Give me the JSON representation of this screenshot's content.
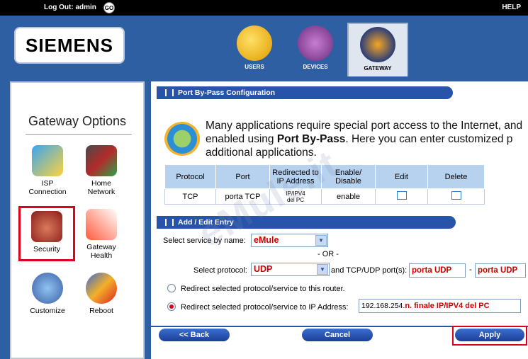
{
  "topbar": {
    "logout_label": "Log Out:",
    "user": "admin",
    "go_label": "GO",
    "help_label": "HELP"
  },
  "header": {
    "logo_text": "SIEMENS",
    "tabs": [
      {
        "label": "USERS",
        "icon": "users-icon"
      },
      {
        "label": "DEVICES",
        "icon": "devices-icon"
      },
      {
        "label": "GATEWAY",
        "icon": "gateway-icon",
        "active": true
      }
    ]
  },
  "sidebar": {
    "title": "Gateway Options",
    "items": [
      {
        "label_1": "ISP",
        "label_2": "Connection",
        "icon": "isp-connection-icon"
      },
      {
        "label_1": "Home",
        "label_2": "Network",
        "icon": "home-network-icon"
      },
      {
        "label_1": "Security",
        "label_2": "",
        "icon": "security-lock-icon",
        "highlighted": true
      },
      {
        "label_1": "Gateway",
        "label_2": "Health",
        "icon": "thermometer-icon"
      },
      {
        "label_1": "Customize",
        "label_2": "",
        "icon": "palette-icon"
      },
      {
        "label_1": "Reboot",
        "label_2": "",
        "icon": "reboot-icon"
      }
    ]
  },
  "portbypass": {
    "section_title": "Port By-Pass Configuration",
    "intro_part1": "Many applications require special port access to the Internet, and",
    "intro_part2": "enabled using ",
    "intro_bold": "Port By-Pass",
    "intro_part3": ". Here you can enter customized p",
    "intro_part4": "additional applications.",
    "table": {
      "headers": [
        "Protocol",
        "Port",
        "Redirected to",
        "IP Address",
        "Enable/",
        "Disable",
        "Edit",
        "Delete"
      ],
      "row": {
        "protocol": "TCP",
        "port": "porta TCP",
        "ip_1": "IP/IPV4",
        "ip_2": "del PC",
        "status": "enable"
      }
    }
  },
  "entry": {
    "section_title": "Add / Edit Entry",
    "service_label": "Select service by name:",
    "service_value": "eMule",
    "or_label": "- OR -",
    "protocol_label": "Select protocol:",
    "protocol_value": "UDP",
    "ports_label": "and TCP/UDP port(s):",
    "port_from": "porta UDP",
    "port_sep": "-",
    "port_to": "porta UDP",
    "radio1_label": "Redirect selected protocol/service to this router.",
    "radio2_label": "Redirect selected protocol/service to IP Address:",
    "ip_prefix": "192.168.254.",
    "ip_suffix": "n. finale IP/IPV4 del PC"
  },
  "buttons": {
    "back": "<< Back",
    "cancel": "Cancel",
    "apply": "Apply"
  },
  "watermark": "eMule.it"
}
